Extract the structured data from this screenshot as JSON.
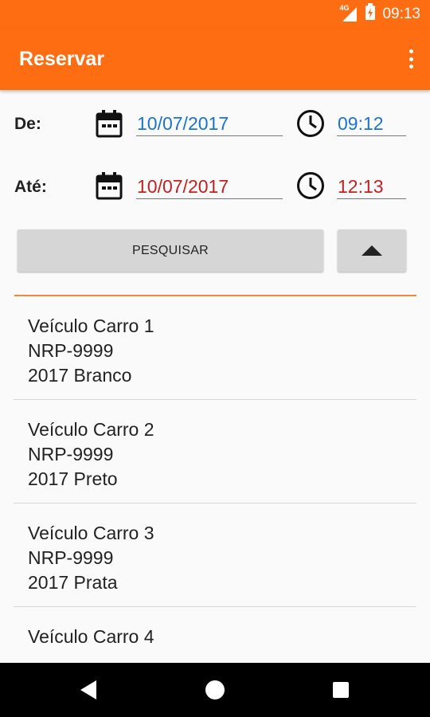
{
  "status_bar": {
    "network": "4G",
    "time": "09:13"
  },
  "app_bar": {
    "title": "Reservar"
  },
  "form": {
    "from": {
      "label": "De:",
      "date": "10/07/2017",
      "time": "09:12"
    },
    "to": {
      "label": "Até:",
      "date": "10/07/2017",
      "time": "12:13"
    },
    "search_label": "PESQUISAR"
  },
  "vehicles": [
    {
      "name": "Veículo Carro 1",
      "plate": "NRP-9999",
      "details": "2017 Branco"
    },
    {
      "name": "Veículo Carro 2",
      "plate": "NRP-9999",
      "details": "2017 Preto"
    },
    {
      "name": "Veículo Carro 3",
      "plate": "NRP-9999",
      "details": "2017 Prata"
    },
    {
      "name": "Veículo Carro 4",
      "plate": "",
      "details": ""
    }
  ],
  "colors": {
    "primary": "#ff6d12",
    "from_value": "#1a73d9",
    "to_value": "#c62020",
    "divider": "#f08a3a"
  },
  "icons": [
    "signal-icon",
    "battery-charging-icon",
    "overflow-menu-icon",
    "calendar-icon",
    "clock-icon",
    "caret-up-icon",
    "nav-back-icon",
    "nav-home-icon",
    "nav-recents-icon"
  ]
}
